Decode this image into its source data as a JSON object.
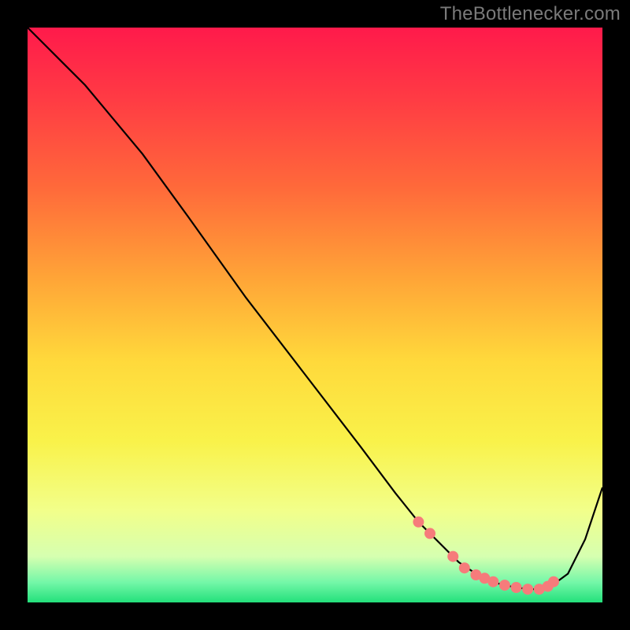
{
  "attribution": "TheBottlenecker.com",
  "chart_data": {
    "type": "line",
    "title": "",
    "xlabel": "",
    "ylabel": "",
    "xlim": [
      0,
      100
    ],
    "ylim": [
      0,
      100
    ],
    "background_gradient": {
      "stops": [
        {
          "offset": 0.0,
          "color": "#ff1a4b"
        },
        {
          "offset": 0.12,
          "color": "#ff3a44"
        },
        {
          "offset": 0.28,
          "color": "#ff6a3a"
        },
        {
          "offset": 0.44,
          "color": "#ffa637"
        },
        {
          "offset": 0.58,
          "color": "#ffd93b"
        },
        {
          "offset": 0.72,
          "color": "#f9f24a"
        },
        {
          "offset": 0.84,
          "color": "#f2ff8a"
        },
        {
          "offset": 0.92,
          "color": "#d6ffb0"
        },
        {
          "offset": 0.965,
          "color": "#74f7a8"
        },
        {
          "offset": 1.0,
          "color": "#23e07b"
        }
      ]
    },
    "series": [
      {
        "name": "bottleneck-curve",
        "color": "#000000",
        "x": [
          0,
          3,
          6,
          10,
          15,
          20,
          28,
          38,
          48,
          58,
          64,
          68,
          72,
          75,
          78,
          81,
          84,
          87,
          89,
          91,
          94,
          97,
          100
        ],
        "y": [
          100,
          97,
          94,
          90,
          84,
          78,
          67,
          53,
          40,
          27,
          19,
          14,
          10,
          7,
          5,
          3.5,
          2.8,
          2.3,
          2.3,
          2.8,
          5,
          11,
          20
        ]
      }
    ],
    "markers": {
      "name": "highlight-points",
      "color": "#f67b7b",
      "radius": 7,
      "x": [
        68,
        70,
        74,
        76,
        78,
        79.5,
        81,
        83,
        85,
        87,
        89,
        90.5,
        91.5
      ],
      "y": [
        14,
        12,
        8,
        6,
        4.8,
        4.2,
        3.6,
        3.0,
        2.6,
        2.3,
        2.3,
        2.8,
        3.6
      ]
    }
  }
}
